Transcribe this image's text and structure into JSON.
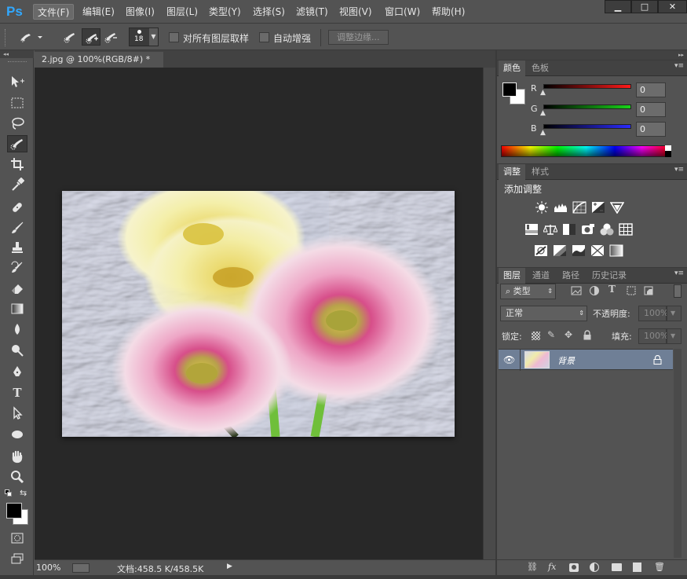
{
  "app": {
    "logo": "Ps"
  },
  "menu": [
    {
      "label": "文件(F)"
    },
    {
      "label": "编辑(E)"
    },
    {
      "label": "图像(I)"
    },
    {
      "label": "图层(L)"
    },
    {
      "label": "类型(Y)"
    },
    {
      "label": "选择(S)"
    },
    {
      "label": "滤镜(T)"
    },
    {
      "label": "视图(V)"
    },
    {
      "label": "窗口(W)"
    },
    {
      "label": "帮助(H)"
    }
  ],
  "window_controls": {
    "minimize": "▁",
    "maximize": "□",
    "close": "✕"
  },
  "options": {
    "brush_size": "18",
    "sample_all_label": "对所有图层取样",
    "auto_enhance_label": "自动增强",
    "refine_edge_label": "调整边缘..."
  },
  "document": {
    "tab_title": "2.jpg @ 100%(RGB/8#) *",
    "tab_close": "×",
    "zoom": "100%",
    "doc_size": "文档:458.5 K/458.5K",
    "status_arrow": "▶"
  },
  "color_panel": {
    "tabs": [
      "颜色",
      "色板"
    ],
    "channels": [
      {
        "label": "R",
        "value": "0",
        "color": "#ff1a1a"
      },
      {
        "label": "G",
        "value": "0",
        "color": "#19d419"
      },
      {
        "label": "B",
        "value": "0",
        "color": "#2b2bff"
      }
    ]
  },
  "adjust_panel": {
    "tabs": [
      "调整",
      "样式"
    ],
    "title": "添加调整"
  },
  "layers_panel": {
    "tabs": [
      "图层",
      "通道",
      "路径",
      "历史记录"
    ],
    "filter_kind": "类型",
    "blend_mode": "正常",
    "opacity_label": "不透明度:",
    "opacity_value": "100%",
    "lock_label": "锁定:",
    "fill_label": "填充:",
    "fill_value": "100%",
    "layer_name": "背景"
  },
  "colors": {
    "foreground": "#000000",
    "background": "#ffffff",
    "accent": "#31a8ff",
    "selected_layer": "#6f7f96"
  }
}
